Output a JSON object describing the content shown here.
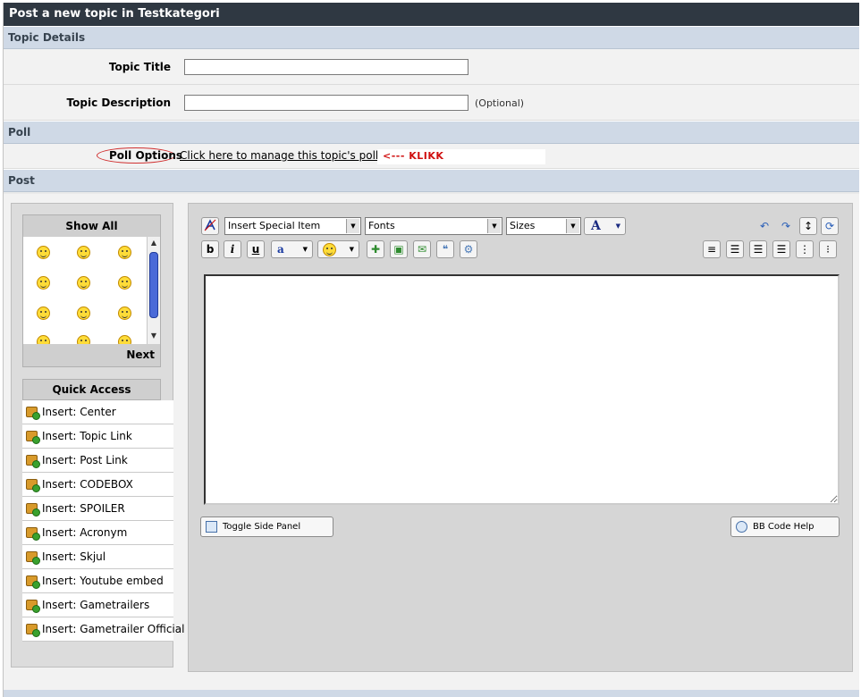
{
  "window": {
    "title": "Post a new topic in Testkategori"
  },
  "sections": {
    "topic_details": "Topic Details",
    "poll": "Poll",
    "post": "Post"
  },
  "topic_title": {
    "label": "Topic Title",
    "value": ""
  },
  "topic_description": {
    "label": "Topic Description",
    "value": "",
    "optional_note": "(Optional)"
  },
  "poll_row": {
    "label": "Poll Options",
    "link": "Click here to manage this topic's poll",
    "annotation": "<--- KLIKK",
    "annotation_color": "#d01010"
  },
  "emoticons": {
    "header": "Show All",
    "next": "Next",
    "icons": [
      "smiley-icon",
      "smiley-icon",
      "smiley-icon",
      "smiley-icon",
      "smiley-icon",
      "smiley-icon",
      "smiley-icon",
      "smiley-icon",
      "smiley-icon",
      "smiley-icon",
      "smiley-icon",
      "smiley-icon"
    ]
  },
  "quick_access": {
    "header": "Quick Access",
    "items": [
      "Insert: Center",
      "Insert: Topic Link",
      "Insert: Post Link",
      "Insert: CODEBOX",
      "Insert: SPOILER",
      "Insert: Acronym",
      "Insert: Skjul",
      "Insert: Youtube embed",
      "Insert: Gametrailers",
      "Insert: Gametrailer Official"
    ]
  },
  "toolbar": {
    "special_item": "Insert Special Item",
    "fonts": "Fonts",
    "sizes": "Sizes",
    "color_letter": "A",
    "bold": "b",
    "italic": "i",
    "underline": "u",
    "highlight": "a"
  },
  "editor": {
    "content": ""
  },
  "buttons": {
    "toggle_side_panel": "Toggle Side Panel",
    "bbcode_help": "BB Code Help"
  },
  "colors": {
    "title_bar": "#2f3842",
    "section_bar": "#cfd9e6"
  }
}
